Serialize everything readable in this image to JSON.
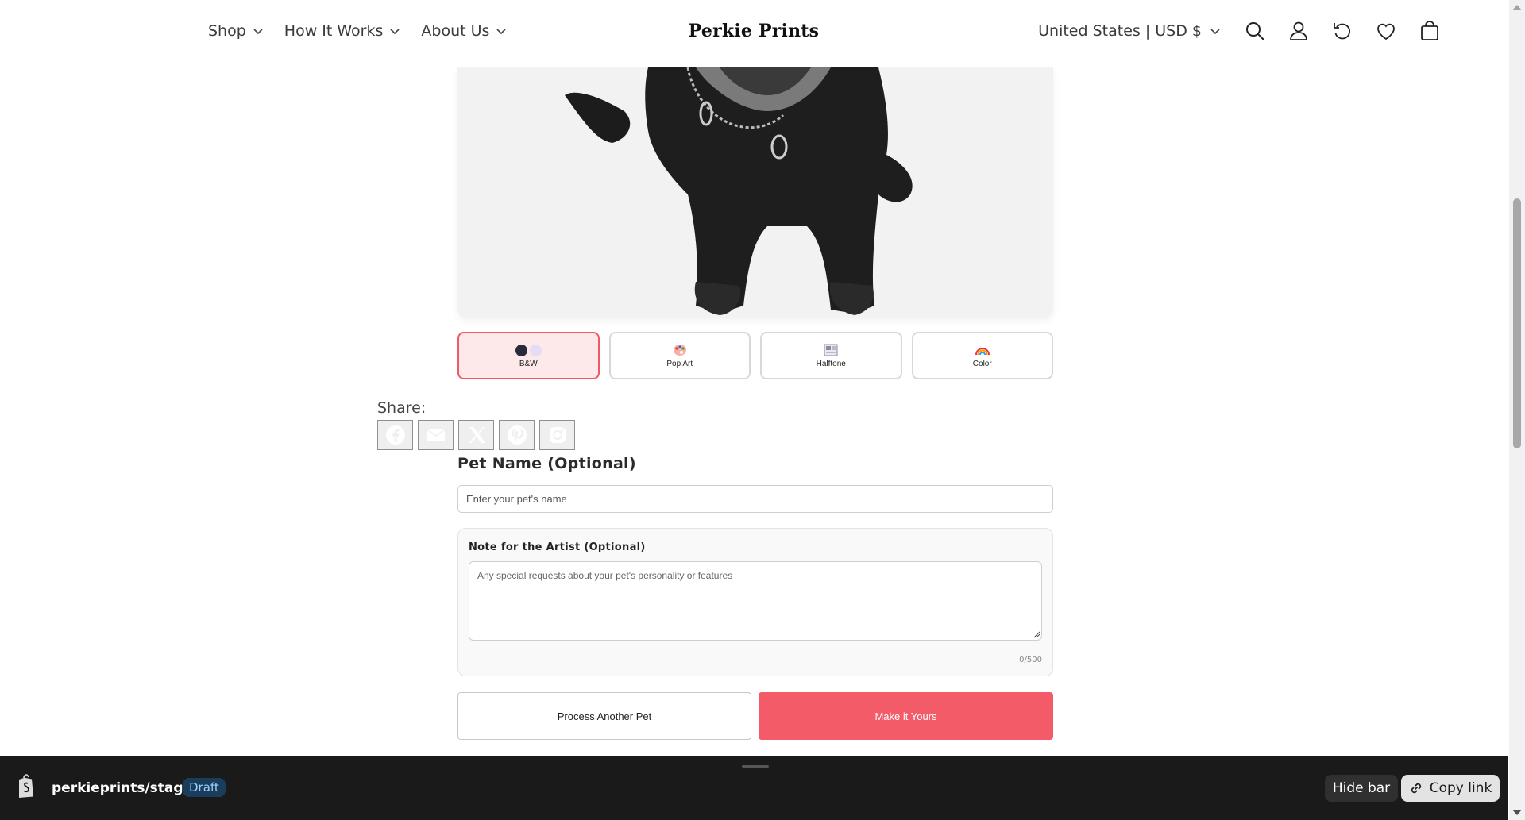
{
  "header": {
    "nav": [
      {
        "label": "Shop"
      },
      {
        "label": "How It Works"
      },
      {
        "label": "About Us"
      }
    ],
    "logo": "Perkie Prints",
    "locale": "United States | USD $",
    "icons": [
      "search-icon",
      "account-icon",
      "history-icon",
      "wishlist-icon",
      "cart-icon"
    ]
  },
  "preview": {
    "image": "dog-black-white-portrait"
  },
  "styles": {
    "options": [
      {
        "label": "B&W",
        "active": true
      },
      {
        "label": "Pop Art",
        "active": false
      },
      {
        "label": "Halftone",
        "active": false
      },
      {
        "label": "Color",
        "active": false
      }
    ]
  },
  "share": {
    "label": "Share:",
    "buttons": [
      "facebook-icon",
      "email-icon",
      "x-icon",
      "pinterest-icon",
      "instagram-icon"
    ]
  },
  "pet_name": {
    "title": "Pet Name (Optional)",
    "placeholder": "Enter your pet's name",
    "value": ""
  },
  "note": {
    "title": "Note for the Artist (Optional)",
    "placeholder": "Any special requests about your pet's personality or features",
    "counter": "0/500"
  },
  "actions": {
    "secondary": "Process Another Pet",
    "primary": "Make it Yours"
  },
  "bottombar": {
    "store": "perkieprints/staging",
    "badge": "Draft",
    "hide": "Hide bar",
    "copy": "Copy link"
  },
  "colors": {
    "accent": "#f35b69",
    "active_bg": "#fde8ea",
    "bar_bg": "#1a1a1a"
  }
}
